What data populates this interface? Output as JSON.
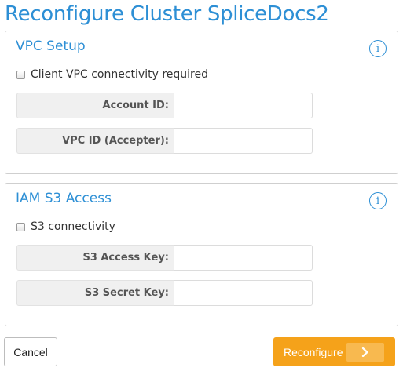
{
  "page": {
    "title": "Reconfigure Cluster SpliceDocs2"
  },
  "vpc_setup": {
    "title": "VPC Setup",
    "info_icon": "info-circle-icon",
    "checkbox_label": "Client VPC connectivity required",
    "checkbox_checked": false,
    "fields": [
      {
        "label": "Account ID:",
        "value": "",
        "placeholder": ""
      },
      {
        "label": "VPC ID (Accepter):",
        "value": "",
        "placeholder": ""
      }
    ]
  },
  "iam_s3": {
    "title": "IAM S3 Access",
    "info_icon": "info-circle-icon",
    "checkbox_label": "S3 connectivity",
    "checkbox_checked": false,
    "fields": [
      {
        "label": "S3 Access Key:",
        "value": "",
        "placeholder": ""
      },
      {
        "label": "S3 Secret Key:",
        "value": "",
        "placeholder": ""
      }
    ]
  },
  "actions": {
    "cancel_label": "Cancel",
    "reconfigure_label": "Reconfigure",
    "reconfigure_icon": "chevron-right-icon"
  },
  "colors": {
    "accent": "#2d8fd5",
    "primary_button": "#f5a21a"
  }
}
